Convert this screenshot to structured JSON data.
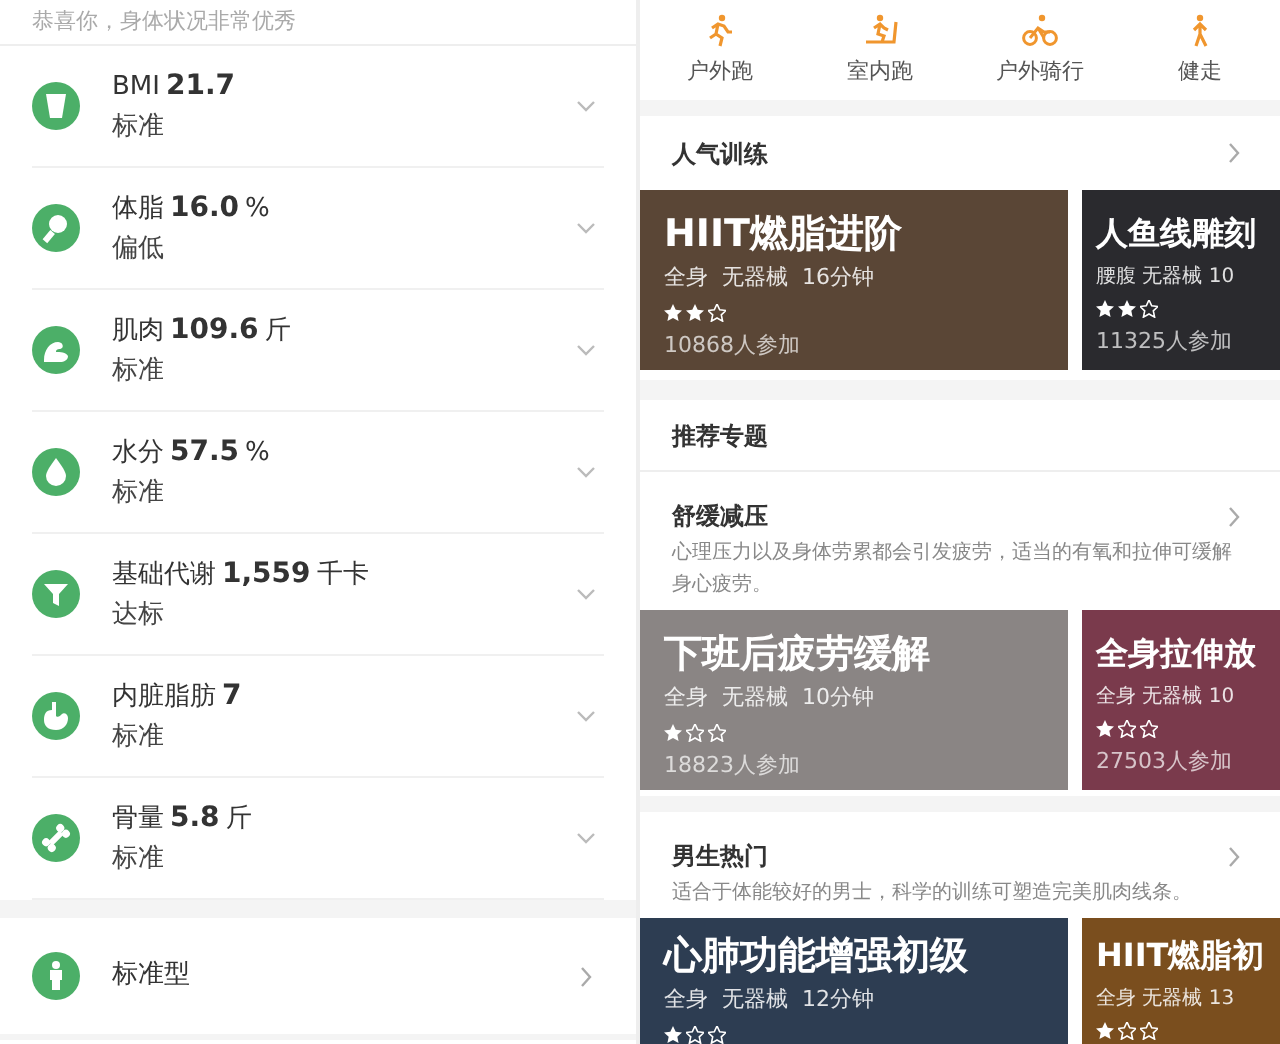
{
  "body_report": {
    "summary": "恭喜你，身体状况非常优秀",
    "metrics": [
      {
        "label": "BMI",
        "value": "21.7",
        "status": "标准"
      },
      {
        "label": "体脂",
        "value": "16.0",
        "unit": "%",
        "status": "偏低"
      },
      {
        "label": "肌肉",
        "value": "109.6",
        "unit": "斤",
        "status": "标准"
      },
      {
        "label": "水分",
        "value": "57.5",
        "unit": "%",
        "status": "标准"
      },
      {
        "label": "基础代谢",
        "value": "1,559",
        "unit": "千卡",
        "status": "达标"
      },
      {
        "label": "内脏脂肪",
        "value": "7",
        "status": "标准"
      },
      {
        "label": "骨量",
        "value": "5.8",
        "unit": "斤",
        "status": "标准"
      }
    ],
    "body_type": "标准型"
  },
  "workout": {
    "sports": [
      "户外跑",
      "室内跑",
      "户外骑行",
      "健走"
    ],
    "sections": [
      {
        "title": "人气训练",
        "cards": [
          {
            "title": "HIIT燃脂进阶",
            "meta": "全身  无器械  16分钟",
            "stars": 2,
            "participants": "10868人参加",
            "color": "#5a4636"
          },
          {
            "title": "人鱼线雕刻",
            "meta": "腰腹 无器械 10",
            "stars": 2,
            "participants": "11325人参加",
            "color": "#2a2a2e"
          }
        ]
      },
      {
        "title": "推荐专题"
      },
      {
        "title": "舒缓减压",
        "description": "心理压力以及身体劳累都会引发疲劳，适当的有氧和拉伸可缓解身心疲劳。",
        "cards": [
          {
            "title": "下班后疲劳缓解",
            "meta": "全身  无器械  10分钟",
            "stars": 1,
            "participants": "18823人参加",
            "color": "#8a8584"
          },
          {
            "title": "全身拉伸放",
            "meta": "全身 无器械 10",
            "stars": 1,
            "participants": "27503人参加",
            "color": "#7a3a4c"
          }
        ]
      },
      {
        "title": "男生热门",
        "description": "适合于体能较好的男士，科学的训练可塑造完美肌肉线条。",
        "cards": [
          {
            "title": "心肺功能增强初级",
            "meta": "全身  无器械  12分钟",
            "stars": 1,
            "color": "#2d3d52"
          },
          {
            "title": "HIIT燃脂初",
            "meta": "全身 无器械 13",
            "stars": 1,
            "color": "#7a4e1e"
          }
        ]
      }
    ]
  }
}
